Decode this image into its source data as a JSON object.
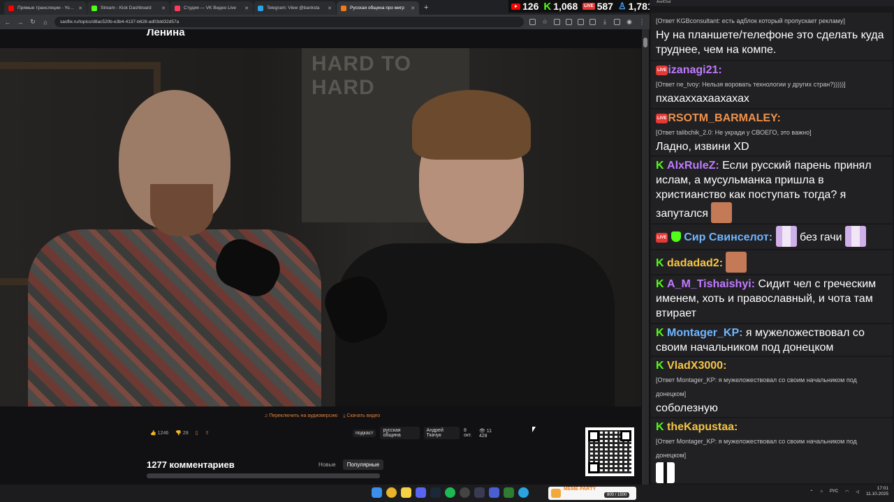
{
  "browser": {
    "tabs": [
      {
        "label": "Прямые трансляции - YouTube",
        "color": "#ff0000"
      },
      {
        "label": "Stream - Kick Dashboard",
        "color": "#53fc18"
      },
      {
        "label": "Студия — VK Видео Live",
        "color": "#ff3b5c"
      },
      {
        "label": "Telegram: View @banksta",
        "color": "#2aa3e0"
      },
      {
        "label": "Русская община про мигр",
        "color": "#f07a14",
        "active": true
      }
    ],
    "new_tab": "+",
    "url": "sasflix.ru/topics/d8ac520b-e3b4-4137-b628-ad03dd32d57a"
  },
  "stats": {
    "youtube": "126",
    "kick": "1,068",
    "vk_live_label": "LIVE",
    "vk": "587",
    "total": "1,781"
  },
  "page": {
    "headline": "Ленина",
    "audio_link": "Переключить на аудиоверсию",
    "download_link": "Скачать видео",
    "likes": "1246",
    "dislikes": "28",
    "tags": [
      "подкаст",
      "русская община",
      "Андрей Ткачук"
    ],
    "date": "8 окт.",
    "views": "11 428",
    "comments_title": "1277 комментариев",
    "sort_new": "Новые",
    "sort_popular": "Популярные",
    "poster_text": "HARD TO HARD"
  },
  "chat": {
    "title": "AxelChat",
    "messages": [
      {
        "reply": "[Ответ KGBconsultant: есть адблок который пропускает рекламу]",
        "text": "Ну на планшете/телефоне это сделать куда труднее, чем на компе."
      },
      {
        "user": "izanagi21:",
        "color": "#c07bff",
        "reply": "[Ответ ne_tvoy: Нельзя воровать технологии у других стран?)))))]",
        "text": "пхахаххахаахахах"
      },
      {
        "user": "RSOTM_BARMALEY:",
        "color": "#f0924a",
        "reply": "[Ответ talibchik_2.0: Не укради у СВОЕГО, это важно]",
        "text": "Ладно, извини XD"
      },
      {
        "user": "AlxRuleZ:",
        "color": "#c07bff",
        "text": "Если русский парень принял ислам, а мусульманка пришла в христианство как поступать тогда? я запутался"
      },
      {
        "user": "Сир Свинселот:",
        "color": "#6fb6ff",
        "text": "без гачи"
      },
      {
        "user": "dadadad2:",
        "color": "#f5c542",
        "text": ""
      },
      {
        "user": "A_M_Tishaishyi:",
        "color": "#c07bff",
        "text": "Сидит чел с греческим именем, хоть и православный, и чота там втирает"
      },
      {
        "user": "Montager_KP:",
        "color": "#6fb6ff",
        "text": "я мужеложествовал со своим начальником под донецком"
      },
      {
        "user": "VladX3000:",
        "color": "#f5c542",
        "reply": "[Ответ Montager_KP: я мужеложествовал со своим начальником под донецком]",
        "text": "соболезную"
      },
      {
        "user": "theKapustaa:",
        "color": "#f5c542",
        "reply": "[Ответ Montager_KP: я мужеложествовал со своим начальником под донецком]",
        "text": ""
      }
    ]
  },
  "taskbar": {
    "party_title": "MEME PARTY",
    "party_count": "800 / 1500",
    "lang": "РУС",
    "time": "17:01",
    "date": "11.10.2025"
  }
}
